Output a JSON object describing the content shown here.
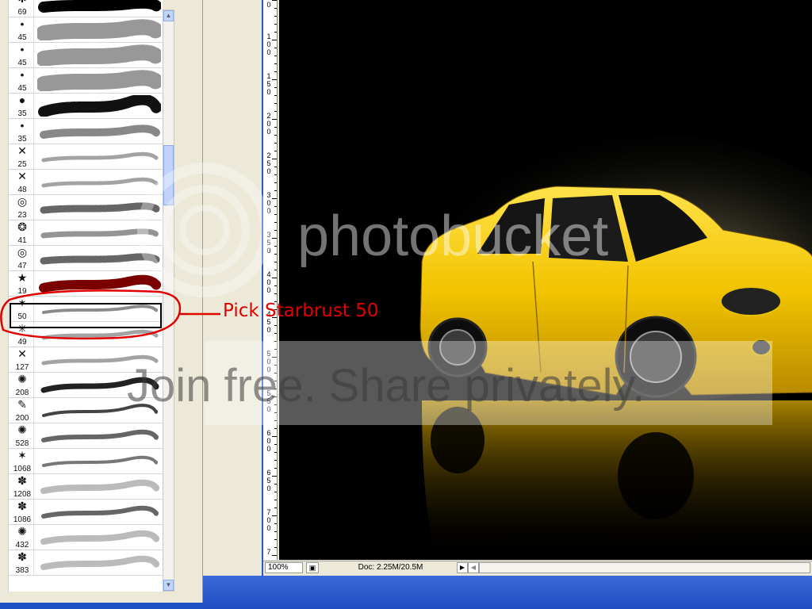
{
  "brushes": [
    {
      "size": "69",
      "glyph": "✱",
      "style": "splat"
    },
    {
      "size": "45",
      "glyph": "•",
      "style": "scatter"
    },
    {
      "size": "45",
      "glyph": "•",
      "style": "scatter"
    },
    {
      "size": "45",
      "glyph": "•",
      "style": "scatter"
    },
    {
      "size": "35",
      "glyph": "●",
      "style": "heavy"
    },
    {
      "size": "35",
      "glyph": "•",
      "style": "speckle"
    },
    {
      "size": "25",
      "glyph": "✕",
      "style": "light"
    },
    {
      "size": "48",
      "glyph": "✕",
      "style": "light"
    },
    {
      "size": "23",
      "glyph": "◎",
      "style": "rings"
    },
    {
      "size": "41",
      "glyph": "❂",
      "style": "rings-light"
    },
    {
      "size": "47",
      "glyph": "◎",
      "style": "rings"
    },
    {
      "size": "19",
      "glyph": "★",
      "style": "stars"
    },
    {
      "size": "50",
      "glyph": "✶",
      "style": "starburst"
    },
    {
      "size": "49",
      "glyph": "✳",
      "style": "light"
    },
    {
      "size": "127",
      "glyph": "✕",
      "style": "light"
    },
    {
      "size": "208",
      "glyph": "✺",
      "style": "dark"
    },
    {
      "size": "200",
      "glyph": "✎",
      "style": "dark-thin"
    },
    {
      "size": "528",
      "glyph": "✺",
      "style": "medium"
    },
    {
      "size": "1068",
      "glyph": "✶",
      "style": "medium-thin"
    },
    {
      "size": "1208",
      "glyph": "✽",
      "style": "soft"
    },
    {
      "size": "1086",
      "glyph": "✽",
      "style": "medium"
    },
    {
      "size": "432",
      "glyph": "✺",
      "style": "soft"
    },
    {
      "size": "383",
      "glyph": "✽",
      "style": "soft"
    }
  ],
  "selected_index": 12,
  "annotation": "Pick Starbrust 50",
  "ruler_numbers": [
    {
      "digits": [
        "0"
      ]
    },
    {
      "digits": [
        "1",
        "0",
        "0"
      ]
    },
    {
      "digits": [
        "1",
        "5",
        "0"
      ]
    },
    {
      "digits": [
        "2",
        "0",
        "0"
      ]
    },
    {
      "digits": [
        "2",
        "5",
        "0"
      ]
    },
    {
      "digits": [
        "3",
        "0",
        "0"
      ]
    },
    {
      "digits": [
        "3",
        "5",
        "0"
      ]
    },
    {
      "digits": [
        "4",
        "0",
        "0"
      ]
    },
    {
      "digits": [
        "4",
        "5",
        "0"
      ]
    },
    {
      "digits": [
        "5",
        "0",
        "0"
      ]
    },
    {
      "digits": [
        "5",
        "5",
        "0"
      ]
    },
    {
      "digits": [
        "6",
        "0",
        "0"
      ]
    },
    {
      "digits": [
        "6",
        "5",
        "0"
      ]
    },
    {
      "digits": [
        "7",
        "0",
        "0"
      ]
    },
    {
      "digits": [
        "7"
      ]
    }
  ],
  "status": {
    "zoom": "100%",
    "doc_info": "Doc: 2.25M/20.5M"
  },
  "watermark": {
    "brand": "photobucket",
    "tagline": "Join free. Share privately."
  },
  "colors": {
    "annotation": "#e10000",
    "car_body": "#f2c400",
    "canvas_bg": "#000000",
    "panel_bg": "#ECE9D8",
    "accent_blue": "#2b59c7"
  }
}
